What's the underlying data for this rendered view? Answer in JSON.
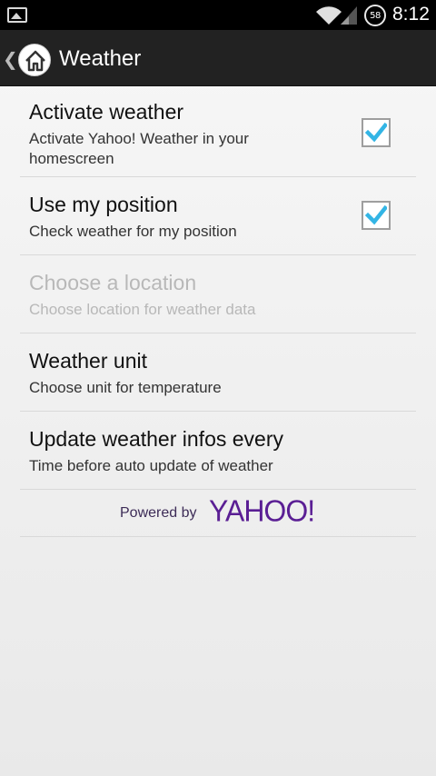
{
  "status_bar": {
    "time": "8:12",
    "battery_level": "58",
    "icons": [
      "gallery-icon",
      "wifi-icon",
      "signal-icon",
      "battery-icon"
    ]
  },
  "action_bar": {
    "title": "Weather",
    "up_icon": "chevron-left-icon",
    "app_icon": "home-icon"
  },
  "preferences": [
    {
      "title": "Activate weather",
      "summary": "Activate Yahoo! Weather in your homescreen",
      "summary_lines": [
        "Activate Yahoo! Weather in your",
        "homescreen"
      ],
      "checkbox": true,
      "checked": true,
      "enabled": true
    },
    {
      "title": "Use my position",
      "summary": "Check weather for my position",
      "checkbox": true,
      "checked": true,
      "enabled": true
    },
    {
      "title": "Choose a location",
      "summary": "Choose location for weather data",
      "checkbox": false,
      "enabled": false
    },
    {
      "title": "Weather unit",
      "summary": "Choose unit for temperature",
      "checkbox": false,
      "enabled": true
    },
    {
      "title": "Update weather infos every",
      "summary": "Time before auto update of weather",
      "checkbox": false,
      "enabled": true
    }
  ],
  "footer": {
    "powered_by": "Powered by",
    "logo": "YAHOO!"
  },
  "colors": {
    "check_accent": "#33b5e5",
    "yahoo_purple": "#5a1e94",
    "action_bar": "#222222",
    "disabled_text": "#b8b8b8"
  }
}
